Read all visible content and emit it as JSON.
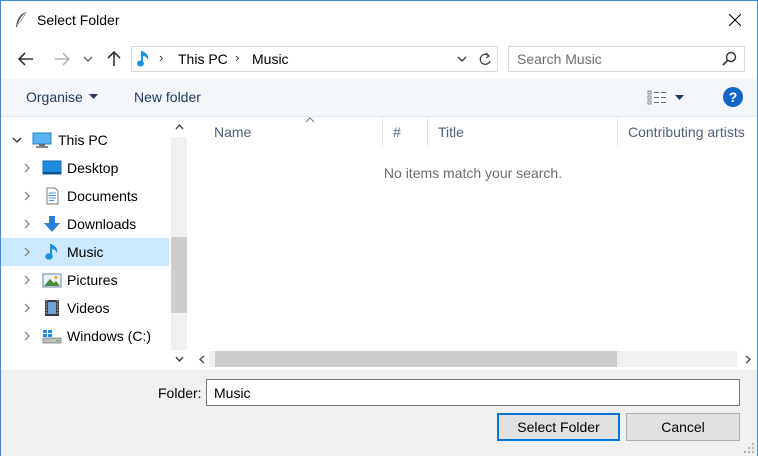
{
  "window": {
    "title": "Select Folder"
  },
  "address": {
    "crumbs": [
      "This PC",
      "Music"
    ]
  },
  "search": {
    "placeholder": "Search Music"
  },
  "toolbar": {
    "organise_label": "Organise",
    "new_folder_label": "New folder",
    "help_label": "?"
  },
  "nav": {
    "items": [
      {
        "label": "This PC",
        "icon": "computer-icon"
      },
      {
        "label": "Desktop",
        "icon": "desktop-icon"
      },
      {
        "label": "Documents",
        "icon": "documents-icon"
      },
      {
        "label": "Downloads",
        "icon": "downloads-icon"
      },
      {
        "label": "Music",
        "icon": "music-icon",
        "selected": true
      },
      {
        "label": "Pictures",
        "icon": "pictures-icon"
      },
      {
        "label": "Videos",
        "icon": "videos-icon"
      },
      {
        "label": "Windows (C:)",
        "icon": "drive-icon"
      }
    ]
  },
  "filelist": {
    "columns": [
      "Name",
      "#",
      "Title",
      "Contributing artists"
    ],
    "empty_message": "No items match your search."
  },
  "footer": {
    "folder_label": "Folder:",
    "folder_value": "Music",
    "select_button": "Select Folder",
    "cancel_button": "Cancel"
  },
  "colors": {
    "accent": "#0078d7",
    "selection": "#cce8ff",
    "toolbar_bg": "#f3f6fb",
    "footer_bg": "#f0f0f0",
    "help_blue": "#1466c6"
  }
}
